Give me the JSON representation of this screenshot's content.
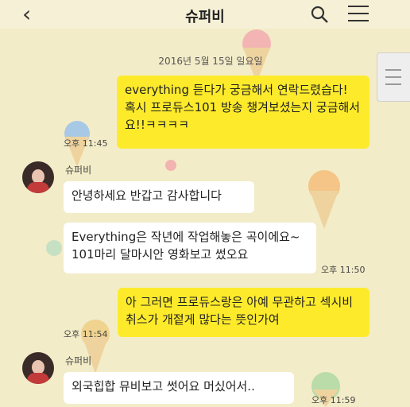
{
  "header": {
    "title": "슈퍼비"
  },
  "date_divider": "2016년 5월 15일 일요일",
  "messages": [
    {
      "text": "everything 듣다가 궁금해서 연락드렸습다! 혹시 프로듀스101 방송 챙겨보셨는지 궁금해서요!!ㅋㅋㅋㅋ",
      "time": "오후 11:45"
    },
    {
      "sender": "슈퍼비",
      "text": "안녕하세요 반갑고 감사합니다"
    },
    {
      "text": "Everything은 작년에 작업해놓은 곡이에요~ 101마리 달마시안 영화보고 썼오요",
      "time": "오후 11:50"
    },
    {
      "text": "아 그러면 프로듀스랑은 아예 무관하고 섹시비취스가 개젙게 많다는 뜻인가여",
      "time": "오후 11:54"
    },
    {
      "sender": "슈퍼비",
      "text": "외국힙합 뮤비보고 썻어요 머싰어서..",
      "time": "오후 11:59"
    }
  ],
  "colors": {
    "my_bubble": "#fdeb2b",
    "their_bubble": "#ffffff",
    "background": "#f3ecc8"
  }
}
